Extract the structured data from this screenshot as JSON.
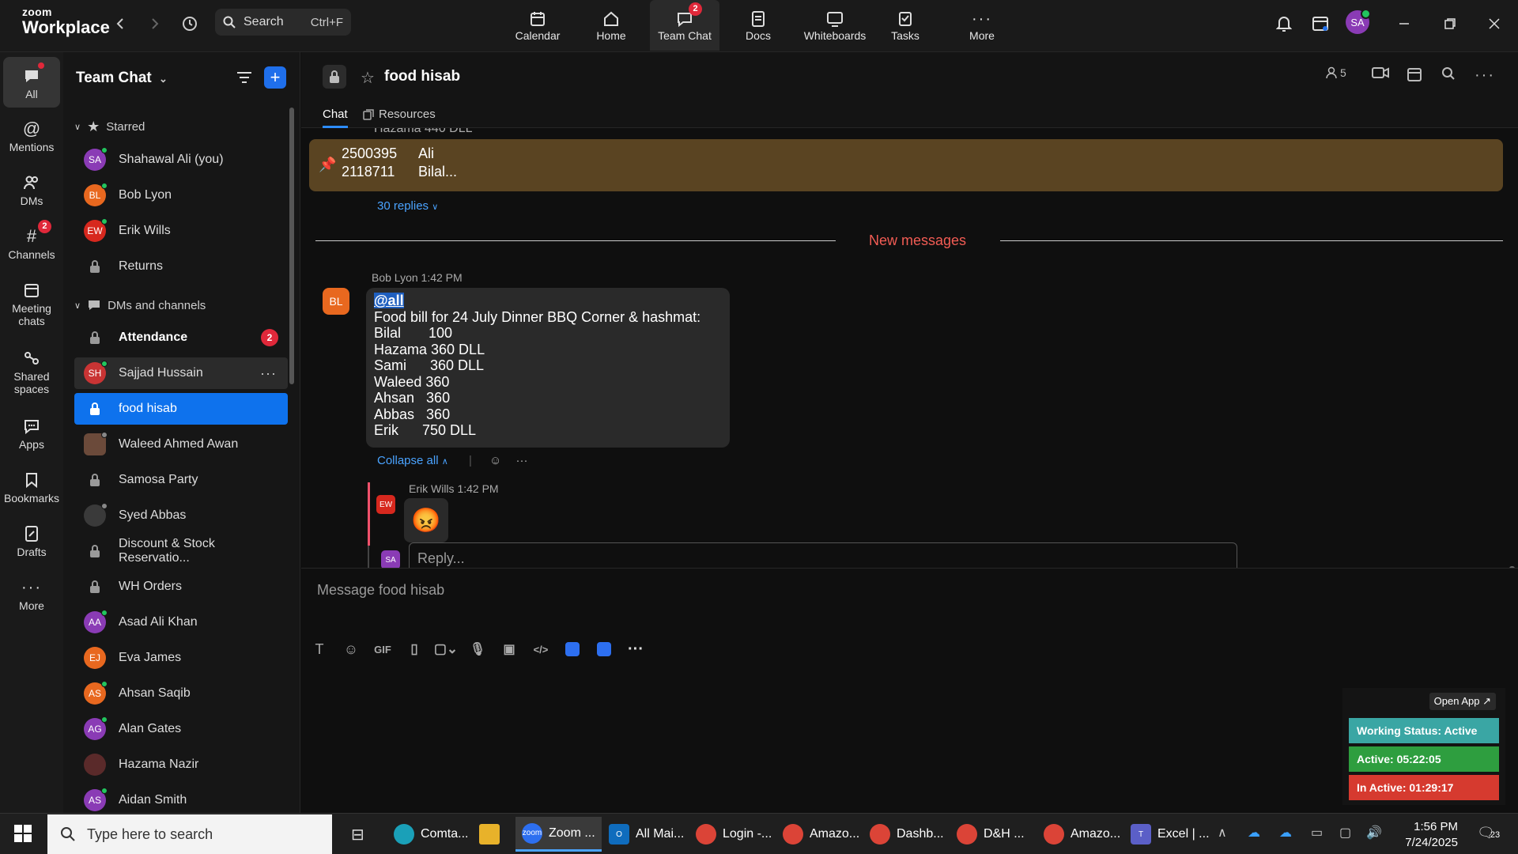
{
  "app": {
    "logo_top": "zoom",
    "logo_bottom": "Workplace"
  },
  "search": {
    "label": "Search",
    "shortcut": "Ctrl+F"
  },
  "nav_tabs": [
    {
      "label": "Calendar"
    },
    {
      "label": "Home"
    },
    {
      "label": "Team Chat",
      "badge": "2"
    },
    {
      "label": "Docs"
    },
    {
      "label": "Whiteboards"
    },
    {
      "label": "Tasks"
    },
    {
      "label": "More"
    }
  ],
  "user_avatar": "SA",
  "rail": [
    {
      "label": "All"
    },
    {
      "label": "Mentions"
    },
    {
      "label": "DMs"
    },
    {
      "label": "Channels",
      "badge": "2"
    },
    {
      "label": "Meeting chats"
    },
    {
      "label": "Shared spaces"
    },
    {
      "label": "Apps"
    },
    {
      "label": "Bookmarks"
    },
    {
      "label": "Drafts"
    },
    {
      "label": "More"
    }
  ],
  "sidebar": {
    "title": "Team Chat",
    "starred_label": "Starred",
    "starred": [
      {
        "initials": "SA",
        "name": "Shahawal Ali (you)",
        "color": "#8a3bb5"
      },
      {
        "initials": "BL",
        "name": "Bob Lyon",
        "color": "#e8681f"
      },
      {
        "initials": "EW",
        "name": "Erik Wills",
        "color": "#d7281e"
      },
      {
        "name": "Returns"
      }
    ],
    "dms_label": "DMs and channels",
    "items": [
      {
        "name": "Attendance",
        "badge": "2"
      },
      {
        "initials": "SH",
        "name": "Sajjad Hussain",
        "color": "#c93434"
      },
      {
        "name": "food hisab"
      },
      {
        "initials": "",
        "name": "Waleed Ahmed Awan",
        "color": "#6b4a3a"
      },
      {
        "name": "Samosa Party"
      },
      {
        "initials": "",
        "name": "Syed Abbas",
        "color": "#3a3a3a"
      },
      {
        "name": "Discount & Stock Reservatio..."
      },
      {
        "name": "WH Orders"
      },
      {
        "initials": "AA",
        "name": "Asad Ali Khan",
        "color": "#8a3bb5"
      },
      {
        "initials": "EJ",
        "name": "Eva James",
        "color": "#e8681f"
      },
      {
        "initials": "AS",
        "name": "Ahsan Saqib",
        "color": "#e8681f"
      },
      {
        "initials": "AG",
        "name": "Alan Gates",
        "color": "#8a3bb5"
      },
      {
        "initials": "",
        "name": "Hazama Nazir",
        "color": "#5a2a2a"
      },
      {
        "initials": "AS",
        "name": "Aidan Smith",
        "color": "#8a3bb5"
      }
    ]
  },
  "channel": {
    "name": "food hisab",
    "members": "5",
    "tabs": {
      "chat": "Chat",
      "resources": "Resources"
    }
  },
  "pinned": {
    "partial": "Hazama 440 DLL",
    "line1_num": "2500395",
    "line1_name": "Ali",
    "line2_num": "2118711",
    "line2_name": "Bilal..."
  },
  "replies": "30 replies",
  "new_messages": "New messages",
  "message": {
    "author": "Bob Lyon",
    "time": "1:42 PM",
    "initials": "BL",
    "mention": "@all",
    "lines": [
      "Food bill for 24 July Dinner BBQ Corner & hashmat:",
      "Bilal       100",
      "Hazama 360 DLL",
      "Sami      360 DLL",
      "Waleed 360",
      "Ahsan   360",
      "Abbas   360",
      "Erik      750 DLL"
    ]
  },
  "collapse": "Collapse all",
  "reply": {
    "author": "Erik Wills",
    "time": "1:42 PM",
    "initials": "EW",
    "emoji": "😡"
  },
  "reply_box": {
    "initials": "SA",
    "placeholder": "Reply..."
  },
  "compose": {
    "placeholder": "Message food hisab"
  },
  "toolbar": {
    "gif": "GIF"
  },
  "widget": {
    "open_app": "Open App ↗",
    "status": "Working Status: Active",
    "active": "Active: 05:22:05",
    "inactive": "In Active: 01:29:17"
  },
  "taskbar": {
    "search_placeholder": "Type here to search",
    "apps": [
      {
        "label": "Comta...",
        "color": "#1aa0b8"
      },
      {
        "label": "",
        "color": "#e8b22a"
      },
      {
        "label": "Zoom ...",
        "color": "#2d6ff0"
      },
      {
        "label": "All Mai...",
        "color": "#0f6cbd"
      },
      {
        "label": "Login -...",
        "color": "#db4437"
      },
      {
        "label": "Amazo...",
        "color": "#db4437"
      },
      {
        "label": "Dashb...",
        "color": "#db4437"
      },
      {
        "label": "D&H ...",
        "color": "#db4437"
      },
      {
        "label": "Amazo...",
        "color": "#db4437"
      },
      {
        "label": "Excel | ...",
        "color": "#5b5fc7"
      }
    ],
    "time": "1:56 PM",
    "date": "7/24/2025",
    "notif": "23"
  }
}
